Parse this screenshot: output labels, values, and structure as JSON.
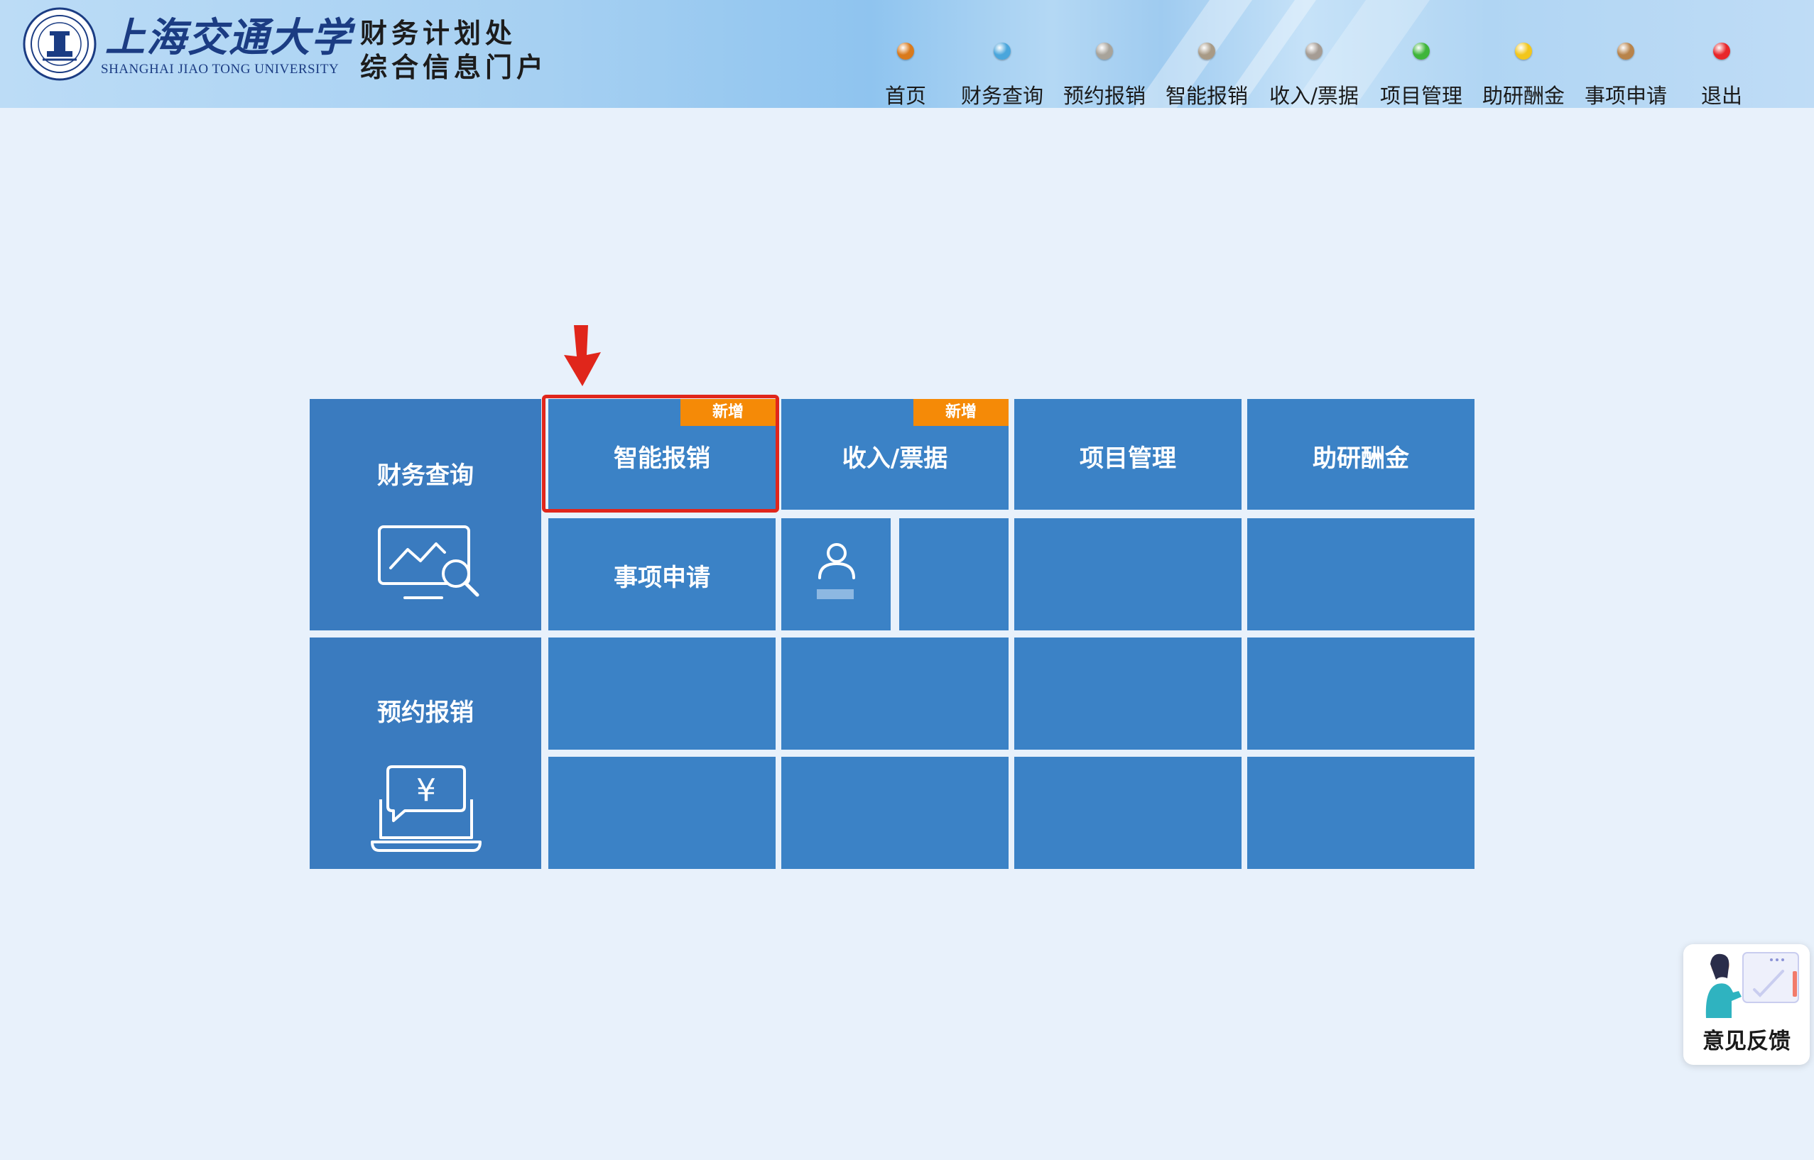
{
  "header": {
    "university_name": "上海交通大学",
    "university_name_en": "SHANGHAI JIAO TONG UNIVERSITY",
    "portal_title_line1": "财务计划处",
    "portal_title_line2": "综合信息门户"
  },
  "nav": [
    {
      "label": "首页",
      "dot_color": "#d97a1c"
    },
    {
      "label": "财务查询",
      "dot_color": "#4aa6dc"
    },
    {
      "label": "预约报销",
      "dot_color": "#a8a39a"
    },
    {
      "label": "智能报销",
      "dot_color": "#a89a86"
    },
    {
      "label": "收入/票据",
      "dot_color": "#a59c94"
    },
    {
      "label": "项目管理",
      "dot_color": "#3fb53a"
    },
    {
      "label": "助研酬金",
      "dot_color": "#f2c61c"
    },
    {
      "label": "事项申请",
      "dot_color": "#b8834a"
    },
    {
      "label": "退出",
      "dot_color": "#e8262a"
    }
  ],
  "tiles": {
    "finance_query": {
      "label": "财务查询",
      "icon": "chart-search-icon"
    },
    "appointment_reimbursement": {
      "label": "预约报销",
      "icon": "yen-laptop-icon"
    },
    "smart_reimbursement": {
      "label": "智能报销",
      "badge": "新增"
    },
    "income_bills": {
      "label": "收入/票据",
      "badge": "新增"
    },
    "project_management": {
      "label": "项目管理"
    },
    "research_pay": {
      "label": "助研酬金"
    },
    "matter_application": {
      "label": "事项申请"
    },
    "user_tile": {
      "icon": "user-icon"
    }
  },
  "feedback": {
    "label": "意见反馈"
  },
  "colors": {
    "tile_blue": "#3b82c6",
    "tile_blue_dark": "#3a7bbf",
    "badge_orange": "#f58a07",
    "highlight_red": "#e0261b",
    "page_bg": "#e8f1fb"
  }
}
